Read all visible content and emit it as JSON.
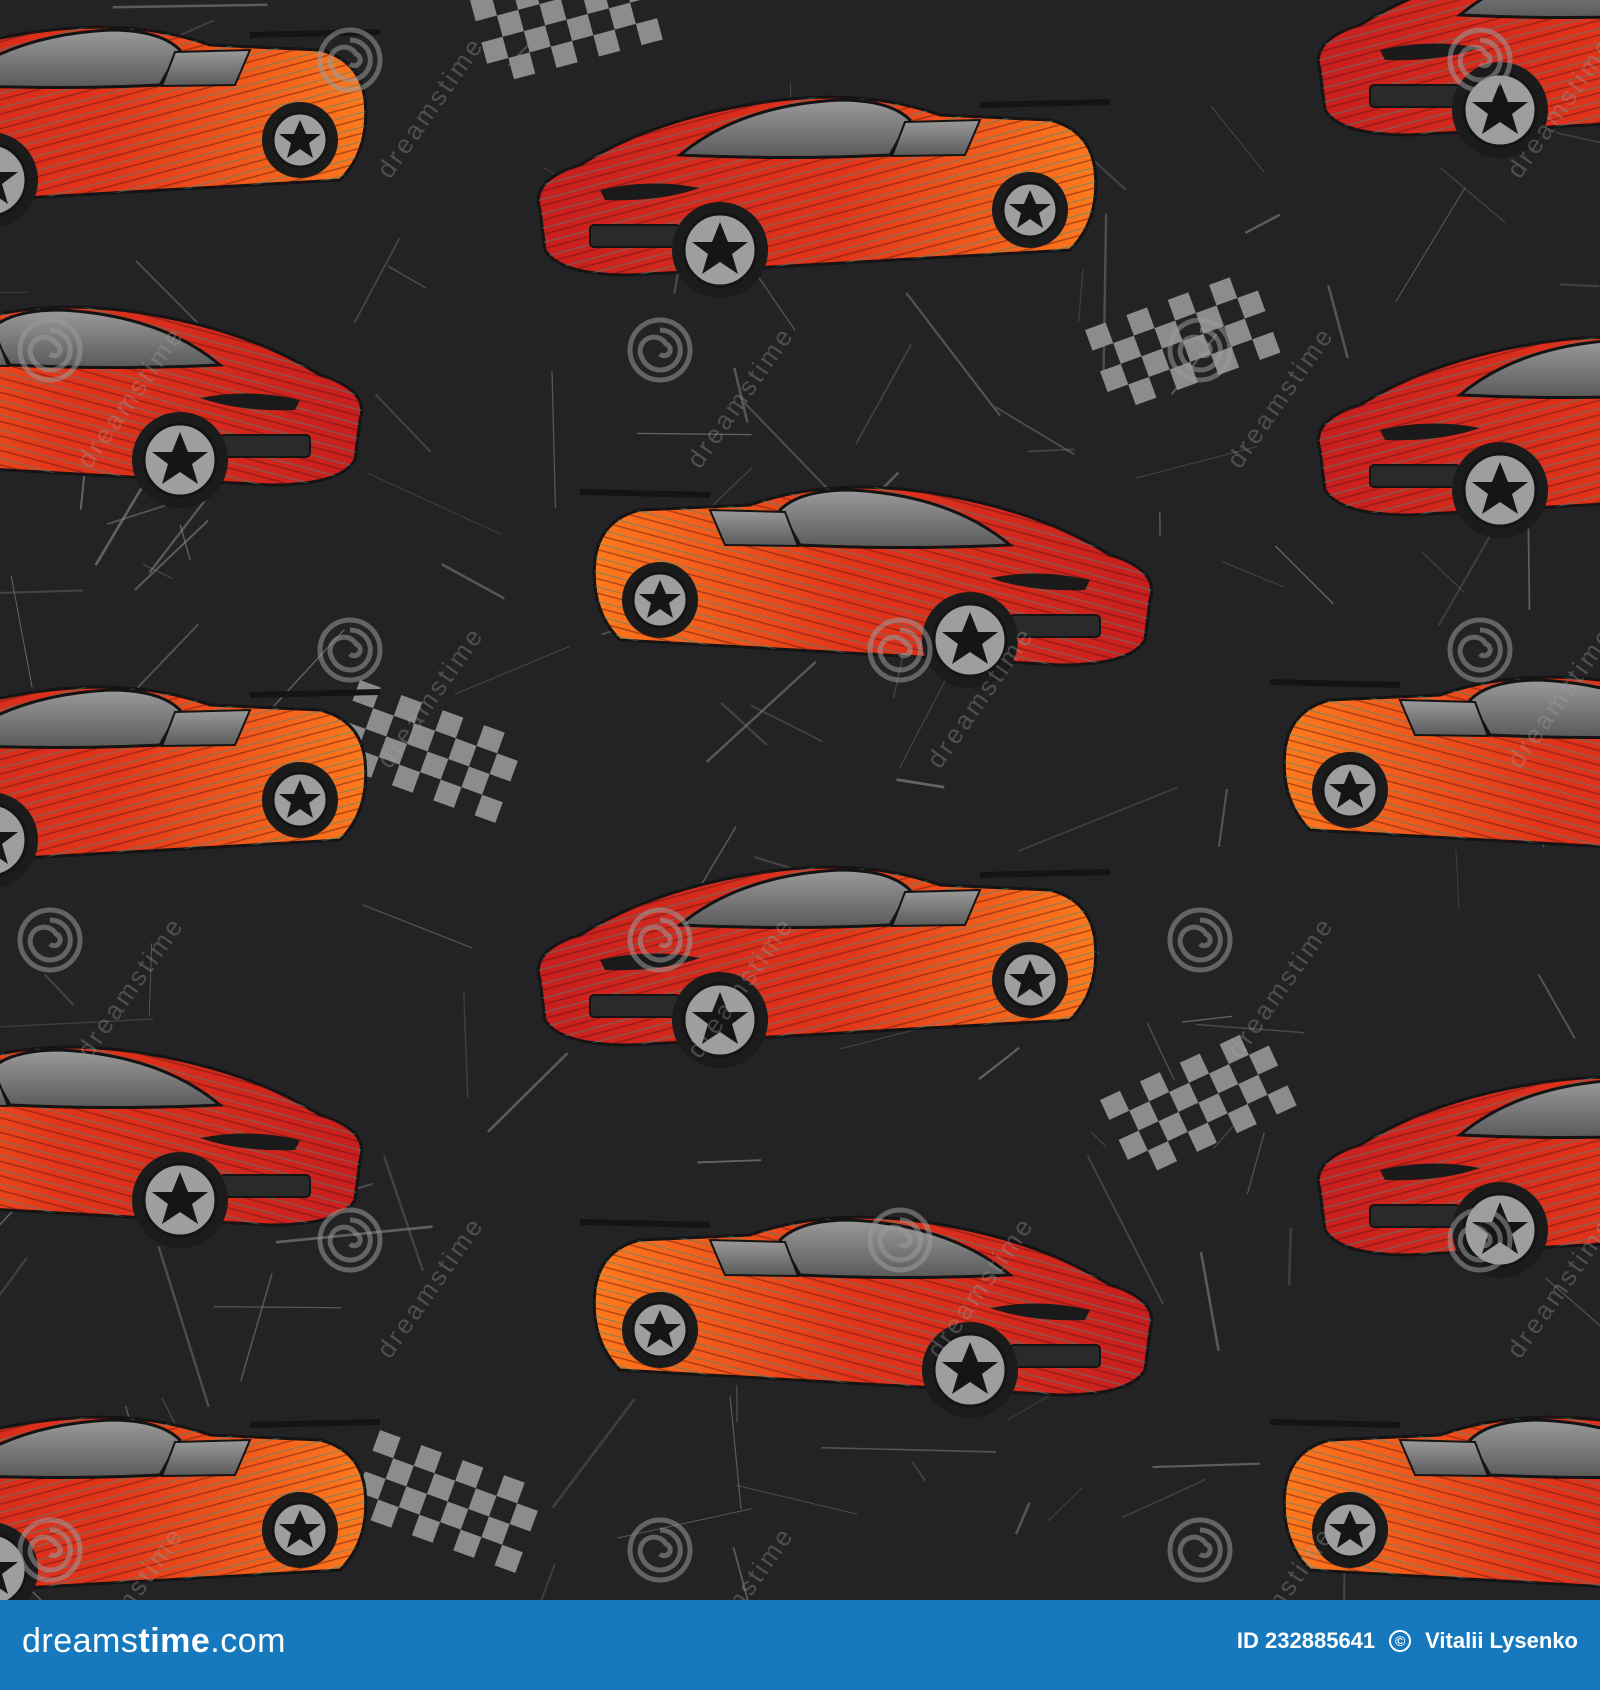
{
  "image": {
    "subject": "seamless pattern",
    "background_color": "#232325",
    "car_colors": [
      "#ff6a1a",
      "#d11f1f",
      "#2f8f84"
    ],
    "flag_color": "#8a8a8a",
    "icons": [
      "race-car-icon",
      "checkered-flag-icon",
      "spiral-watermark-icon"
    ]
  },
  "watermark": {
    "text": "dreamstime"
  },
  "footer": {
    "brand_part1": "dreams",
    "brand_part2": "time",
    "brand_suffix": ".com",
    "id_label": "ID 232885641",
    "author": "Vitalii Lysenko",
    "background_color": "#1679be"
  }
}
